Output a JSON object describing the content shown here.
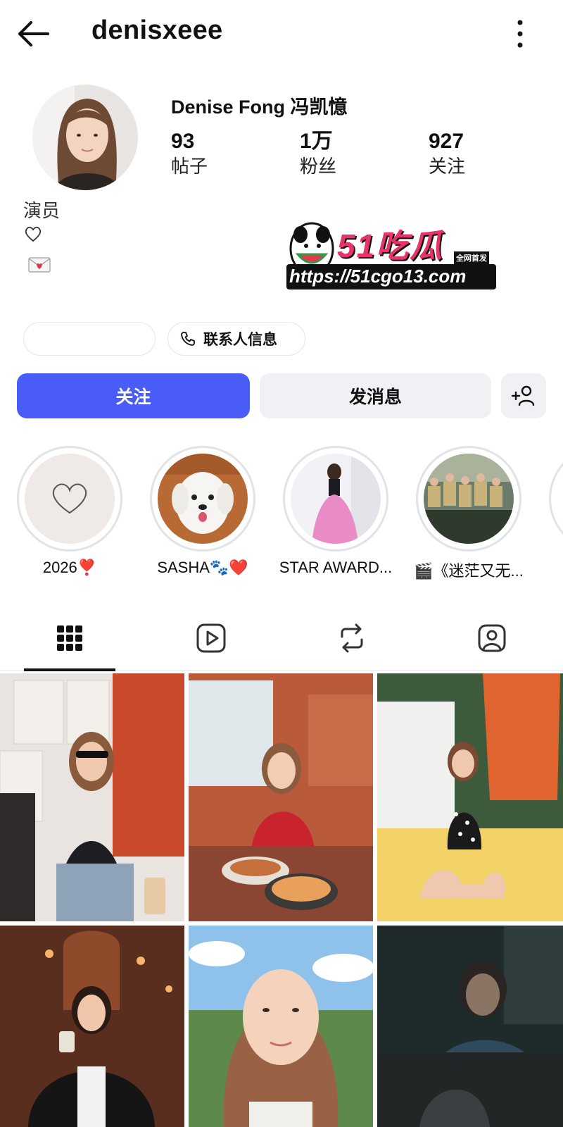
{
  "header": {
    "username": "denisxeee"
  },
  "profile": {
    "display_name": "Denise Fong 冯凯憶",
    "stats": [
      {
        "value": "93",
        "label": "帖子"
      },
      {
        "value": "1万",
        "label": "粉丝"
      },
      {
        "value": "927",
        "label": "关注"
      }
    ],
    "bio_line": "演员"
  },
  "watermark": {
    "brand": "51吃瓜",
    "tag": "全网首发",
    "url": "https://51cgo13.com"
  },
  "chips": {
    "contact_label": "联系人信息"
  },
  "actions": {
    "follow_label": "关注",
    "message_label": "发消息"
  },
  "highlights": [
    {
      "caption": "2026❣️"
    },
    {
      "caption": "SASHA🐾❤️"
    },
    {
      "caption": "STAR AWARD..."
    },
    {
      "caption": "🎬《迷茫又无..."
    }
  ],
  "tabs": [
    {
      "icon": "grid-icon",
      "active": true
    },
    {
      "icon": "reels-icon",
      "active": false
    },
    {
      "icon": "reposts-icon",
      "active": false
    },
    {
      "icon": "tagged-icon",
      "active": false
    }
  ],
  "colors": {
    "accent": "#4a5cf6",
    "button_gray": "#eff1f4"
  }
}
